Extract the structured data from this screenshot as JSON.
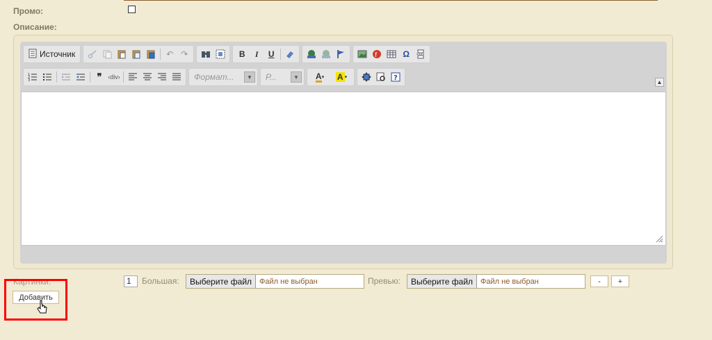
{
  "form": {
    "promo_label": "Промо:",
    "description_label": "Описание:",
    "pictures_label": "Картинки:"
  },
  "editor": {
    "source_label": "Источник",
    "format_placeholder": "Формат...",
    "size_placeholder": "Р...",
    "toolbar_row1": [
      "cut-icon",
      "copy-icon",
      "paste-icon",
      "paste-text-icon",
      "paste-word-icon",
      "undo-icon",
      "redo-icon",
      "find-icon",
      "select-all-icon",
      "bold-icon",
      "italic-icon",
      "underline-icon",
      "remove-format-icon",
      "link-icon",
      "unlink-icon",
      "anchor-icon",
      "image-icon",
      "flash-icon",
      "table-icon",
      "special-char-icon",
      "page-break-icon"
    ],
    "toolbar_row2": [
      "numbered-list-icon",
      "bulleted-list-icon",
      "outdent-icon",
      "indent-icon",
      "blockquote-icon",
      "div-icon",
      "align-left-icon",
      "align-center-icon",
      "align-right-icon",
      "justify-icon",
      "text-color-icon",
      "bg-color-icon",
      "maximize-icon",
      "show-blocks-icon",
      "about-icon"
    ],
    "content": ""
  },
  "pictures": {
    "index": "1",
    "large_label": "Большая:",
    "preview_label": "Превью:",
    "choose_file": "Выберите файл",
    "no_file": "Файл не выбран",
    "minus": "-",
    "plus": "+",
    "add_button": "Добавить"
  },
  "colors": {
    "page_bg": "#f2ebd3",
    "highlight": "#ff0000",
    "label": "#7d7a66"
  }
}
